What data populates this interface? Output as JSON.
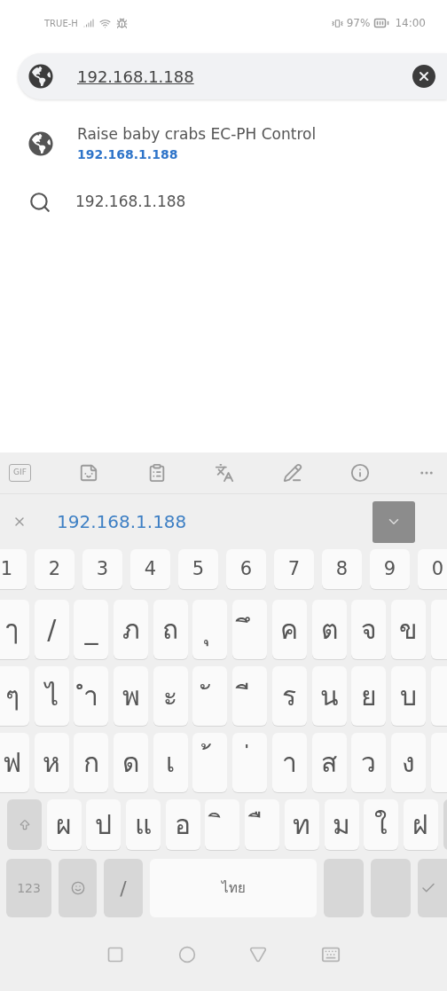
{
  "status_bar": {
    "carrier": "TRUE-H",
    "battery": "97%",
    "time": "14:00"
  },
  "address_bar": {
    "value": "192.168.1.188"
  },
  "suggestions": [
    {
      "kind": "page",
      "title": "Raise baby crabs EC-PH Control",
      "url": "192.168.1.188"
    },
    {
      "kind": "search",
      "title": "192.168.1.188"
    }
  ],
  "keyboard": {
    "toolbar_gif": "GIF",
    "candidate": "192.168.1.188",
    "number_row": [
      "1",
      "2",
      "3",
      "4",
      "5",
      "6",
      "7",
      "8",
      "9",
      "0"
    ],
    "letter_rows": [
      [
        "ๅ",
        "/",
        "_",
        "ภ",
        "ถ",
        "ุ",
        "ึ",
        "ค",
        "ต",
        "จ",
        "ข"
      ],
      [
        "ๆ",
        "ไ",
        "ำ",
        "พ",
        "ะ",
        "ั",
        "ี",
        "ร",
        "น",
        "ย",
        "บ"
      ],
      [
        "ฟ",
        "ห",
        "ก",
        "ด",
        "เ",
        "้",
        "่",
        "า",
        "ส",
        "ว",
        "ง"
      ]
    ],
    "shift_row": [
      "ผ",
      "ป",
      "แ",
      "อ",
      "ิ",
      "ื",
      "ท",
      "ม",
      "ใ",
      "ฝ"
    ],
    "numbers_key": "123",
    "slash_key": "/",
    "space_label": "ไทย"
  }
}
